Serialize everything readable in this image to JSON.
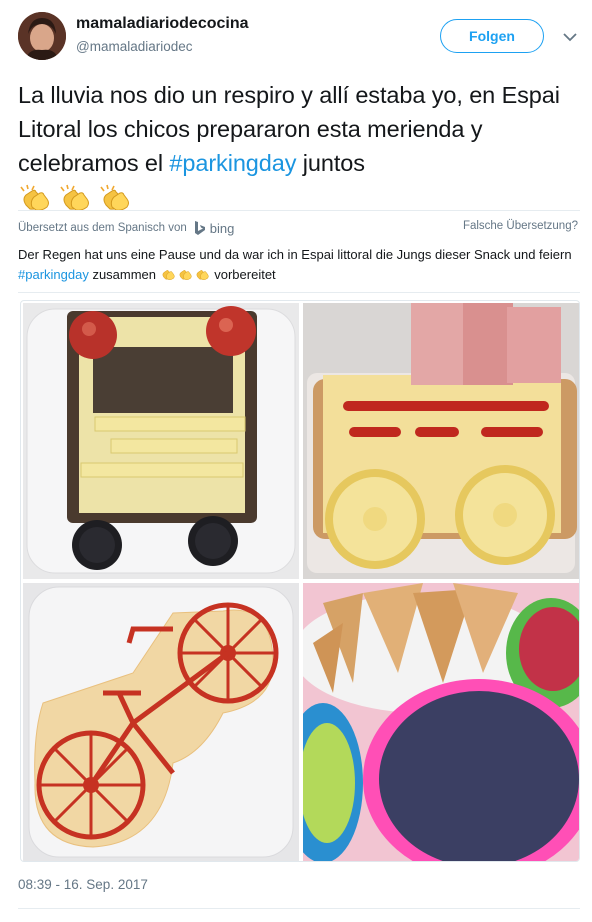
{
  "user": {
    "display_name": "mamaladiariodecocina",
    "handle": "@mamaladiariodec",
    "follow_label": "Folgen"
  },
  "tweet": {
    "text_part1": "La lluvia nos dio un respiro y allí estaba yo, en Espai Litoral los chicos prepararon esta merienda y celebramos el ",
    "hashtag": "#parkingday",
    "text_part2": " juntos",
    "emoji_name": "clapping-hands-icon"
  },
  "translation": {
    "translated_from": "Übersetzt aus dem Spanisch von",
    "provider": "bing",
    "wrong_translation": "Falsche Übersetzung?",
    "text_part1": "Der Regen hat uns eine Pause und da war ich in Espai littoral die Jungs dieser Snack und feiern ",
    "hashtag": "#parkingday",
    "text_part2": " zusammen ",
    "text_part3": " vorbereitet"
  },
  "media": {
    "photos": [
      "bread-bus-photo",
      "cheese-wagon-photo",
      "cheese-bicycle-photo",
      "snack-bowls-photo"
    ]
  },
  "timestamp": "08:39 - 16. Sep. 2017",
  "colors": {
    "accent": "#1da1f2",
    "hashtag": "#1b95e0",
    "muted": "#657786"
  }
}
